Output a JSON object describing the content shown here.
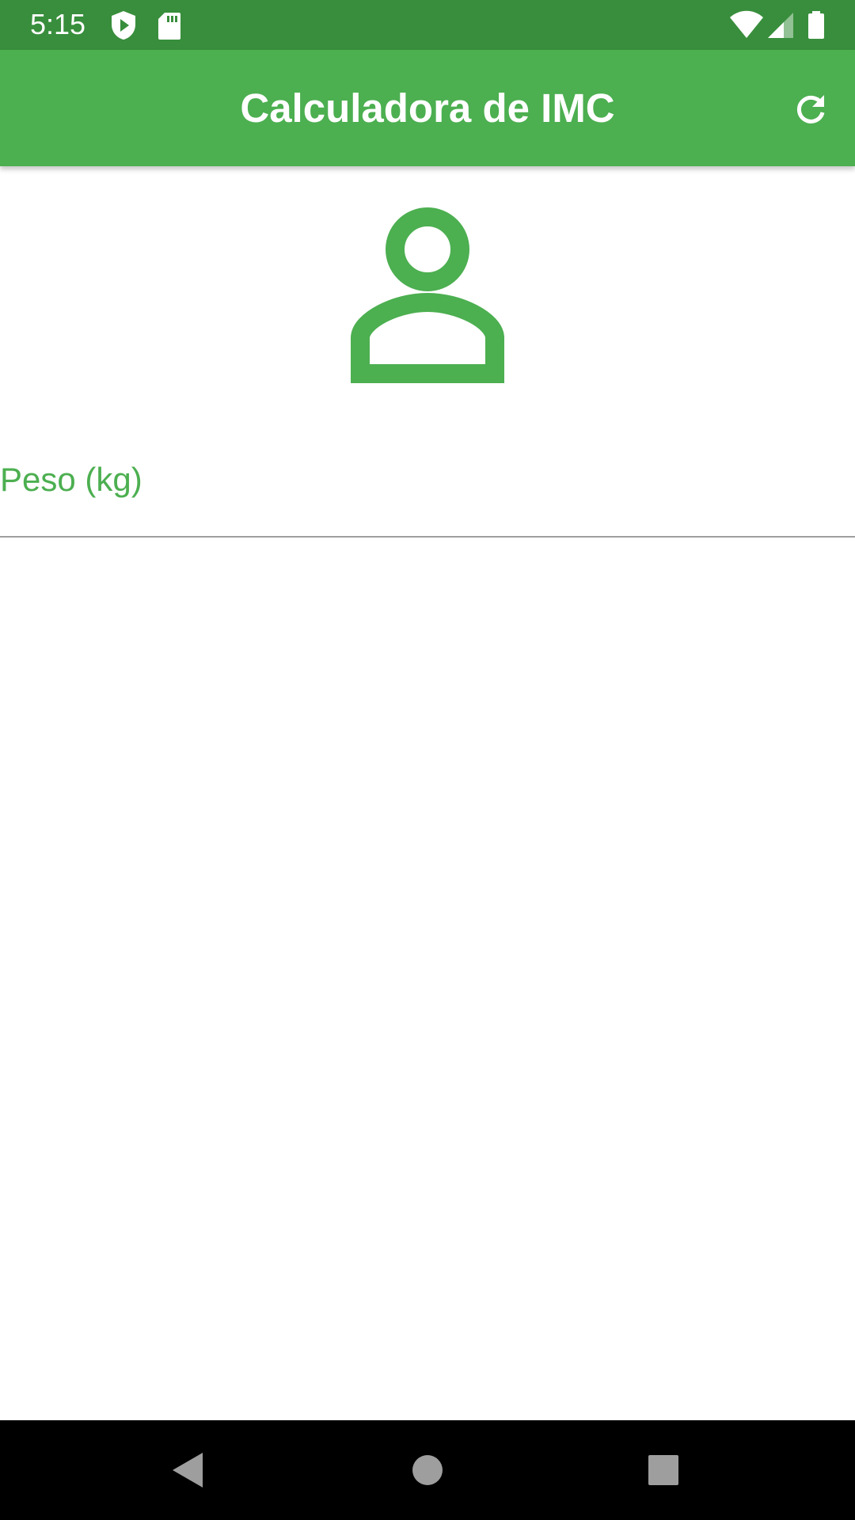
{
  "status_bar": {
    "time": "5:15",
    "left_icons": [
      "shield-play-icon",
      "sd-card-icon"
    ],
    "right_icons": [
      "wifi-icon",
      "cell-signal-icon",
      "battery-icon"
    ]
  },
  "app_bar": {
    "title": "Calculadora de IMC",
    "action_icon": "refresh-icon"
  },
  "content": {
    "avatar_icon": "person-outline-icon",
    "weight_field": {
      "label": "Peso (kg)",
      "value": ""
    }
  },
  "nav_bar": {
    "buttons": [
      "back-icon",
      "home-icon",
      "recents-icon"
    ]
  },
  "colors": {
    "status_bar": "#388e3c",
    "primary": "#4caf50",
    "on_primary": "#ffffff",
    "underline": "#9e9e9e",
    "nav_bar": "#000000",
    "nav_icon": "#9e9e9e"
  }
}
